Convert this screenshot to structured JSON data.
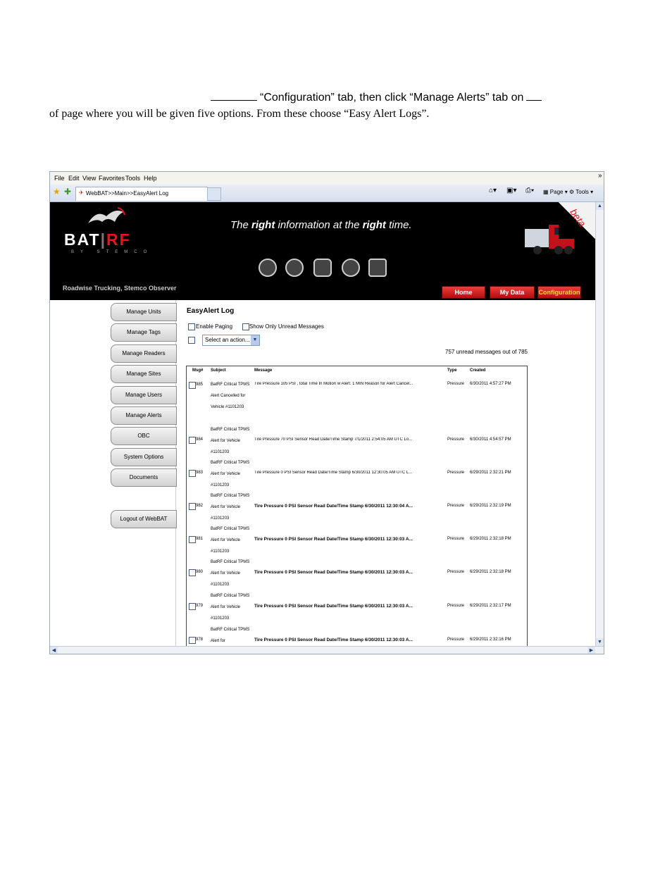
{
  "instruction": {
    "line1": "“Configuration” tab, then click “Manage Alerts” tab on",
    "line2": "of page where you will be given five options.  From these choose “Easy Alert Logs”."
  },
  "browser": {
    "menu": [
      "File",
      "Edit",
      "View",
      "Favorites",
      "Tools",
      "Help"
    ],
    "tab_title": "WebBAT>>Main>>EasyAlert Log",
    "toolbar": {
      "page": "Page",
      "tools": "Tools"
    }
  },
  "site": {
    "logo_bat": "BAT",
    "logo_rf": "RF",
    "logo_sub": "BY STEMCO",
    "tagline_pre": "The ",
    "tagline_b1": "right",
    "tagline_mid": " information at the ",
    "tagline_b2": "right",
    "tagline_post": " time.",
    "beta": "beta",
    "company": "Roadwise Trucking, Stemco Observer",
    "nav": {
      "home": "Home",
      "mydata": "My Data",
      "config": "Configuration"
    }
  },
  "sidebar": {
    "items": [
      "Manage Units",
      "Manage Tags",
      "Manage Readers",
      "Manage Sites",
      "Manage Users",
      "Manage Alerts",
      "OBC",
      "System Options",
      "Documents"
    ],
    "logout": "Logout of WebBAT"
  },
  "log": {
    "title": "EasyAlert Log",
    "enable_paging": "Enable Paging",
    "unread_only": "Show Only Unread Messages",
    "action_select": "Select an action...",
    "count": "757 unread messages out of 785",
    "headers": {
      "msg": "Msg#",
      "subject": "Subject",
      "message": "Message",
      "type": "Type",
      "created": "Created"
    },
    "rows": [
      {
        "num": "985",
        "subject": "BatRF Critical TPMS Alert Cancelled for Vehicle #1101203",
        "message": "Tire Pressure 105 PSI , total Time In Motion w Alert: 1 MIN Reason for Alert Cancel...",
        "bold": false,
        "type": "Pressure",
        "created": "6/30/2011 4:57:27 PM"
      },
      {
        "num": "984",
        "subject": "BatRF Critical TPMS Alert for Vehicle #1101203",
        "message": "Tire Pressure 70 PSI Sensor Read Date/Time Stamp  7/1/2011 2:54:05 AM UTC Lo...",
        "bold": false,
        "type": "Pressure",
        "created": "6/30/2011 4:54:57 PM"
      },
      {
        "num": "983",
        "subject": "BatRF Critical TPMS Alert for Vehicle #1101203",
        "message": "Tire Pressure 0 PSI Sensor Read Date/Time Stamp  6/30/2011 12:30:05 AM UTC L...",
        "bold": false,
        "type": "Pressure",
        "created": "6/29/2011 2:32:21 PM"
      },
      {
        "num": "982",
        "subject": "BatRF Critical TPMS Alert for Vehicle #1101203",
        "message": "Tire Pressure 0 PSI Sensor Read Date/Time Stamp  6/30/2011 12:30:04 A...",
        "bold": true,
        "type": "Pressure",
        "created": "6/29/2011 2:32:19 PM"
      },
      {
        "num": "981",
        "subject": "BatRF Critical TPMS Alert for Vehicle #1101203",
        "message": "Tire Pressure 0 PSI Sensor Read Date/Time Stamp  6/30/2011 12:30:03 A...",
        "bold": true,
        "type": "Pressure",
        "created": "6/29/2011 2:32:18 PM"
      },
      {
        "num": "980",
        "subject": "BatRF Critical TPMS Alert for Vehicle #1101203",
        "message": "Tire Pressure 0 PSI Sensor Read Date/Time Stamp  6/30/2011 12:30:03 A...",
        "bold": true,
        "type": "Pressure",
        "created": "6/29/2011 2:32:18 PM"
      },
      {
        "num": "979",
        "subject": "BatRF Critical TPMS Alert for Vehicle #1101203",
        "message": "Tire Pressure 0 PSI Sensor Read Date/Time Stamp  6/30/2011 12:30:03 A...",
        "bold": true,
        "type": "Pressure",
        "created": "6/29/2011 2:32:17 PM"
      },
      {
        "num": "978",
        "subject": "BatRF Critical TPMS Alert for",
        "message": "Tire Pressure 0 PSI Sensor Read Date/Time Stamp  6/30/2011 12:30:03 A...",
        "bold": true,
        "type": "Pressure",
        "created": "6/29/2011 2:32:16 PM"
      }
    ]
  }
}
